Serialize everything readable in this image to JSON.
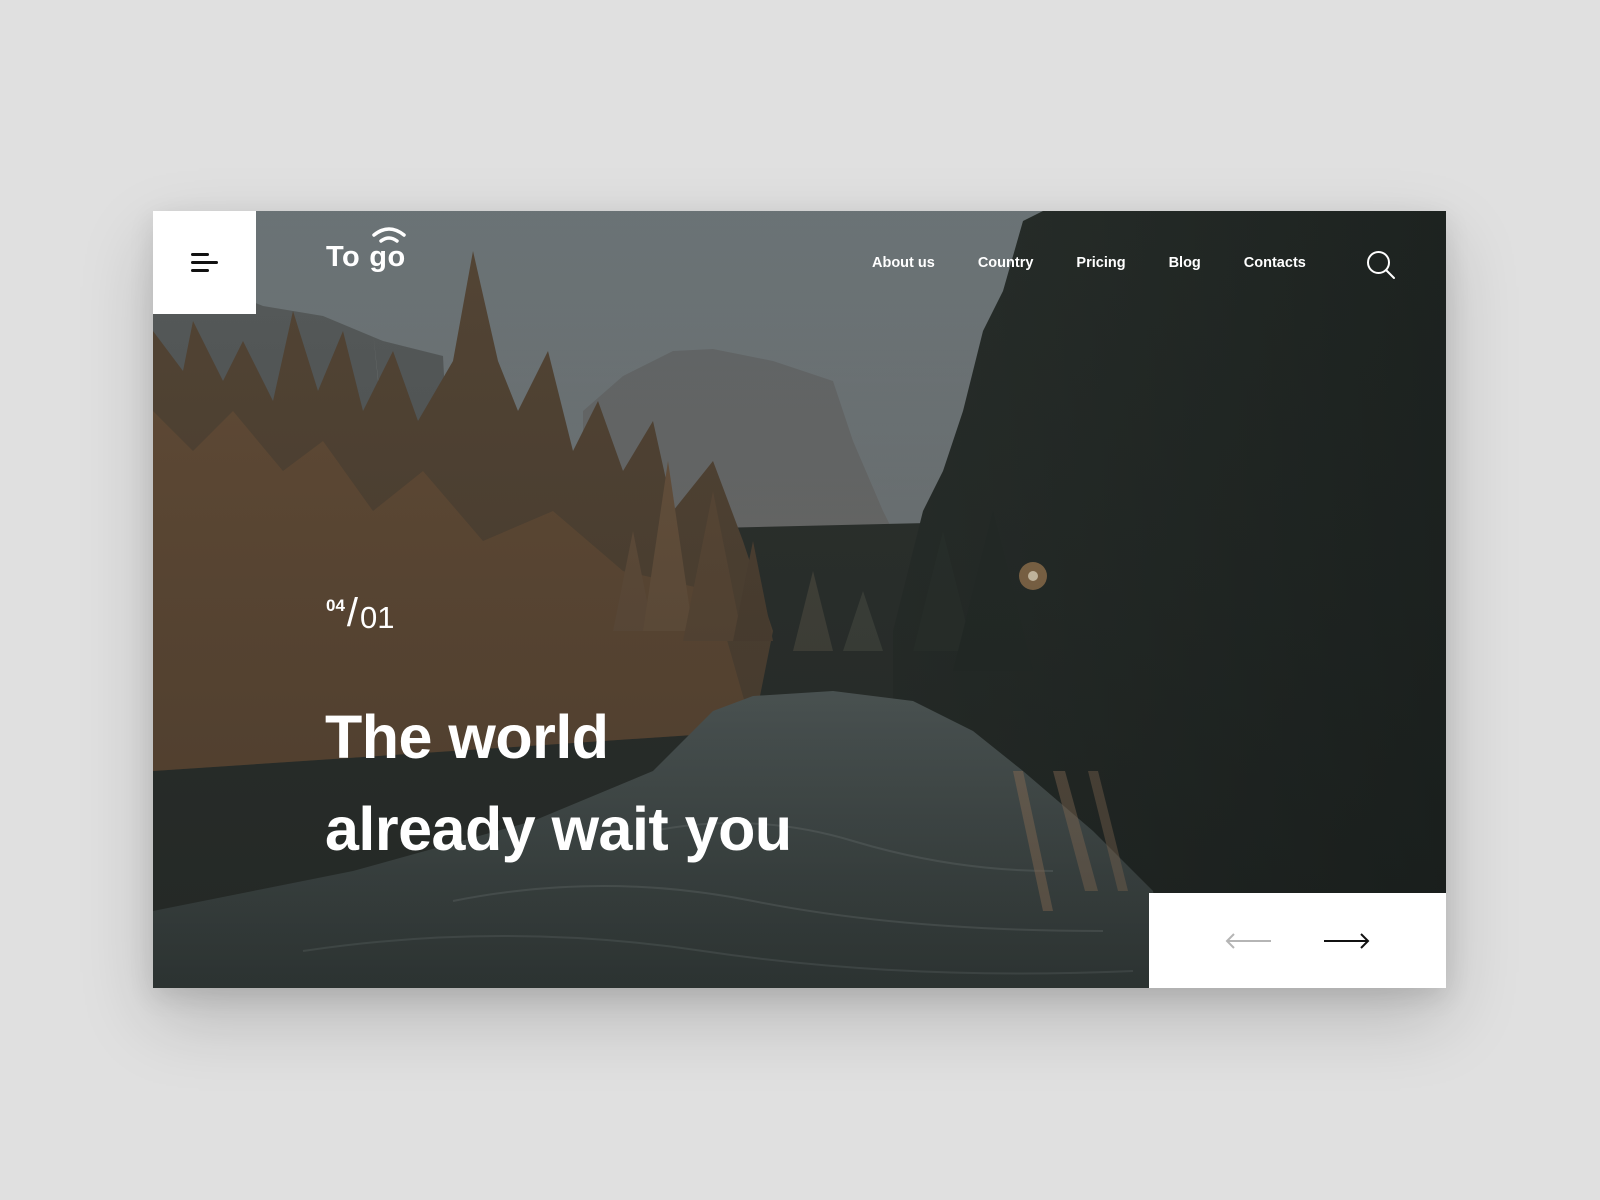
{
  "brand": {
    "logo_word1": "To",
    "logo_word2": "go",
    "logo_icon": "wifi-signal-icon"
  },
  "header": {
    "menu_icon": "hamburger-menu-icon",
    "nav": [
      {
        "label": "About us"
      },
      {
        "label": "Country"
      },
      {
        "label": "Pricing"
      },
      {
        "label": "Blog"
      },
      {
        "label": "Contacts"
      }
    ],
    "search_icon": "search-icon"
  },
  "hero": {
    "slide_total": "04",
    "slide_separator": "/",
    "slide_current": "01",
    "headline_line1": "The world",
    "headline_line2": "already wait you",
    "background": "forest-river-mountain-photo"
  },
  "slider_controls": {
    "prev_icon": "arrow-left-icon",
    "next_icon": "arrow-right-icon",
    "prev_enabled": false,
    "next_enabled": true
  },
  "colors": {
    "page_bg": "#e0e0e0",
    "panel_bg": "#ffffff",
    "text_light": "#ffffff",
    "icon_dark": "#111111",
    "icon_disabled": "#b5b5b5"
  }
}
